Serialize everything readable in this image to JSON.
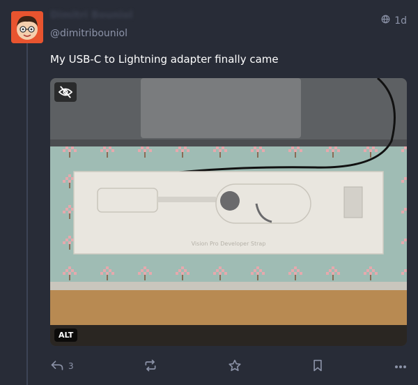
{
  "status": {
    "display_name": "Dimitri Bouniol",
    "handle": "@dimitribouniol",
    "visibility_icon": "globe-icon",
    "timestamp": "1d",
    "text": "My USB-C to Lightning adapter finally came"
  },
  "media": {
    "alt_label": "ALT",
    "hide_icon": "eye-slash-icon",
    "box_print": "Vision Pro Developer Strap"
  },
  "actions": {
    "reply_count": "3",
    "reply_icon": "reply-icon",
    "boost_icon": "boost-icon",
    "favourite_icon": "star-icon",
    "bookmark_icon": "bookmark-icon",
    "more_icon": "more-icon"
  },
  "colors": {
    "background": "#282c37",
    "secondary_text": "#8c93a8",
    "primary_text": "#ffffff",
    "avatar_bg": "#e8542f"
  }
}
